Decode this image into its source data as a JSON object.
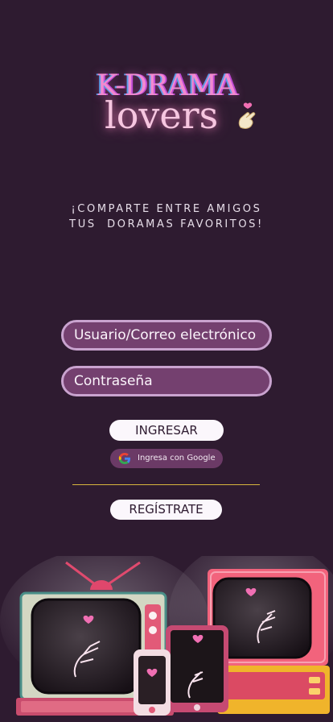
{
  "logo": {
    "line1": "K-DRAMA",
    "line2": "lovers",
    "hand_icon": "finger-heart-icon"
  },
  "tagline": {
    "line1": "¡COMPARTE ENTRE AMIGOS",
    "line2": "TUS  DORAMAS FAVORITOS!"
  },
  "form": {
    "user_placeholder": "Usuario/Correo electrónico",
    "password_placeholder": "Contraseña"
  },
  "buttons": {
    "login": "INGRESAR",
    "google": "Ingresa con Google",
    "register": "REGÍSTRATE"
  },
  "colors": {
    "background": "#2e1b30",
    "field_fill": "#74406f",
    "field_border": "#c9a3cf",
    "divider": "#d7b53d",
    "button_light": "#fbf7fc"
  }
}
